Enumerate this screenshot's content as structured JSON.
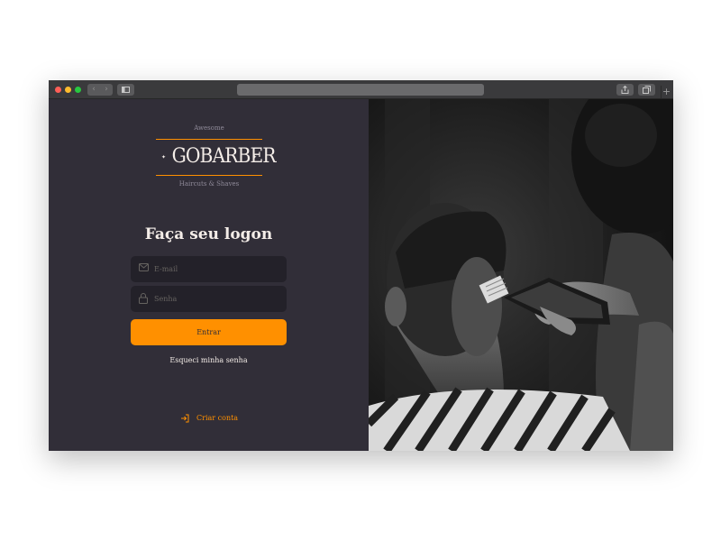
{
  "browser": {
    "nav_back": "‹",
    "nav_forward": "›",
    "new_tab": "+"
  },
  "logo": {
    "top_text": "Awesome",
    "name": "GOBARBER",
    "bottom_text": "Haircuts & Shaves"
  },
  "form": {
    "heading": "Faça seu logon",
    "email_placeholder": "E-mail",
    "password_placeholder": "Senha",
    "submit_label": "Entrar",
    "forgot_label": "Esqueci minha senha"
  },
  "create_account": {
    "label": "Criar conta",
    "icon": "log-in-icon"
  },
  "colors": {
    "background": "#312e38",
    "input_background": "#232129",
    "accent": "#ff9000",
    "text": "#f4ede8",
    "placeholder": "#666360"
  }
}
